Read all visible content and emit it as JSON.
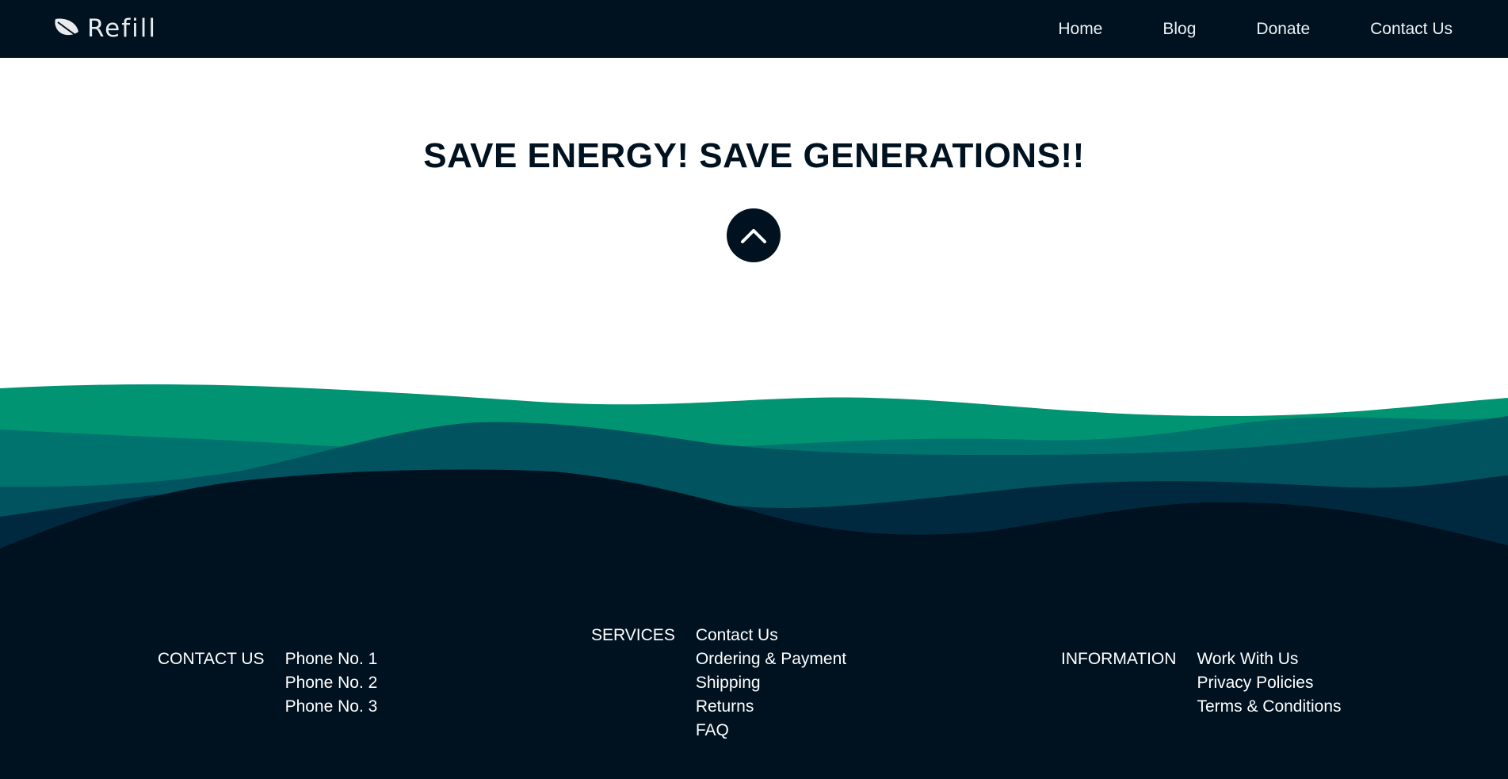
{
  "nav": {
    "brand_icon": "leaf-icon",
    "brand": "Refill",
    "links": [
      "Home",
      "Blog",
      "Donate",
      "Contact Us"
    ]
  },
  "hero": {
    "headline": "SAVE ENERGY! SAVE GENERATIONS!!",
    "scroll_up_icon": "chevron-up-icon"
  },
  "footer": {
    "contact": {
      "heading": "CONTACT US",
      "items": [
        "Phone No. 1",
        "Phone No. 2",
        "Phone No. 3"
      ]
    },
    "services": {
      "heading": "SERVICES",
      "items": [
        "Contact Us",
        "Ordering & Payment",
        "Shipping",
        "Returns",
        "FAQ"
      ]
    },
    "information": {
      "heading": "INFORMATION",
      "items": [
        "Work With Us",
        "Privacy Policies",
        "Terms & Conditions"
      ]
    }
  },
  "colors": {
    "navy": "#001220",
    "green": "#009473",
    "teal": "#00736e",
    "blue_teal": "#00535f",
    "dark_teal": "#00293f",
    "white": "#ffffff"
  }
}
